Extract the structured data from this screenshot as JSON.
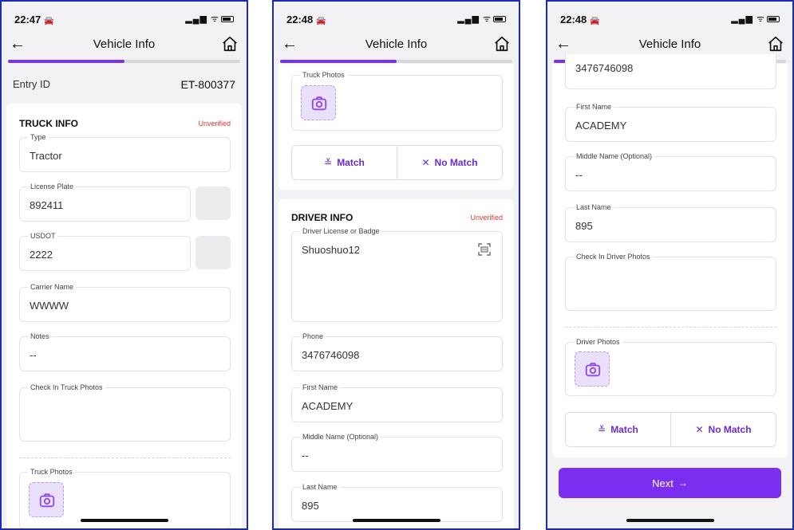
{
  "status_bar": {
    "time_1": "22:47",
    "time_2": "22:48",
    "time_3": "22:48"
  },
  "navbar": {
    "title": "Vehicle Info"
  },
  "progress": {
    "fraction": 0.5
  },
  "entry": {
    "label": "Entry ID",
    "value": "ET-800377"
  },
  "truck_info": {
    "heading": "TRUCK INFO",
    "status": "Unverified",
    "type_label": "Type",
    "type_value": "Tractor",
    "plate_label": "License Plate",
    "plate_value": "892411",
    "usdot_label": "USDOT",
    "usdot_value": "2222",
    "carrier_label": "Carrier Name",
    "carrier_value": "WWWW",
    "notes_label": "Notes",
    "notes_value": "--",
    "checkin_photos_label": "Check In Truck Photos",
    "truck_photos_label": "Truck Photos"
  },
  "match": {
    "match_label": "Match",
    "nomatch_label": "No Match"
  },
  "driver_info": {
    "heading": "DRIVER INFO",
    "status": "Unverified",
    "license_label": "Driver License or Badge",
    "license_value": "Shuoshuo12",
    "phone_label": "Phone",
    "phone_value": "3476746098",
    "first_label": "First Name",
    "first_value": "ACADEMY",
    "middle_label": "Middle Name (Optional)",
    "middle_value": "--",
    "last_label": "Last Name",
    "last_value": "895",
    "checkin_photos_label": "Check In Driver Photos",
    "driver_photos_label": "Driver Photos"
  },
  "next_button": {
    "label": "Next",
    "arrow": "→"
  },
  "icons": {
    "back": "arrow-left-icon",
    "home": "home-icon",
    "camera": "camera-icon",
    "scan": "scan-icon",
    "match": "check-list-icon",
    "nomatch": "close-icon"
  },
  "colors": {
    "accent": "#7a2ef0",
    "unverified": "#e53935",
    "frame": "#1a2bb8"
  }
}
